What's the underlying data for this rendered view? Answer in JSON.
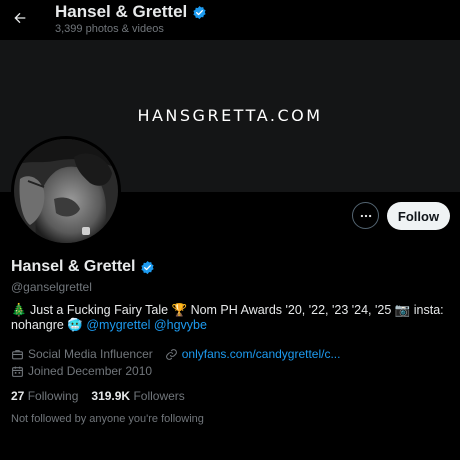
{
  "header": {
    "title": "Hansel & Grettel",
    "subtitle": "3,399 photos & videos",
    "back_icon": "arrow-left-icon"
  },
  "banner": {
    "text": "HANSGRETTA.COM"
  },
  "actions": {
    "more_icon": "more-horizontal-icon",
    "follow_label": "Follow"
  },
  "profile": {
    "display_name": "Hansel & Grettel",
    "handle": "@ganselgrettel",
    "bio": {
      "part1": "🎄 Just a Fucking Fairy Tale 🏆 Nom PH Awards '20, '22, '23 '24, '25 📷 insta: nohangre 🥶 ",
      "mention1": "@mygrettel",
      "mention2": "@hgvybe"
    },
    "category": "Social Media Influencer",
    "website": "onlyfans.com/candygrettel/c...",
    "joined": "Joined December 2010",
    "following_count": "27",
    "following_label": "Following",
    "followers_count": "319.9K",
    "followers_label": "Followers",
    "not_followed_text": "Not followed by anyone you're following"
  },
  "colors": {
    "background": "#000000",
    "accent": "#1d9bf0",
    "verified": "#1d9bf0",
    "muted_text": "#71767b",
    "primary_text": "#e7e9ea",
    "banner": "#141516"
  }
}
